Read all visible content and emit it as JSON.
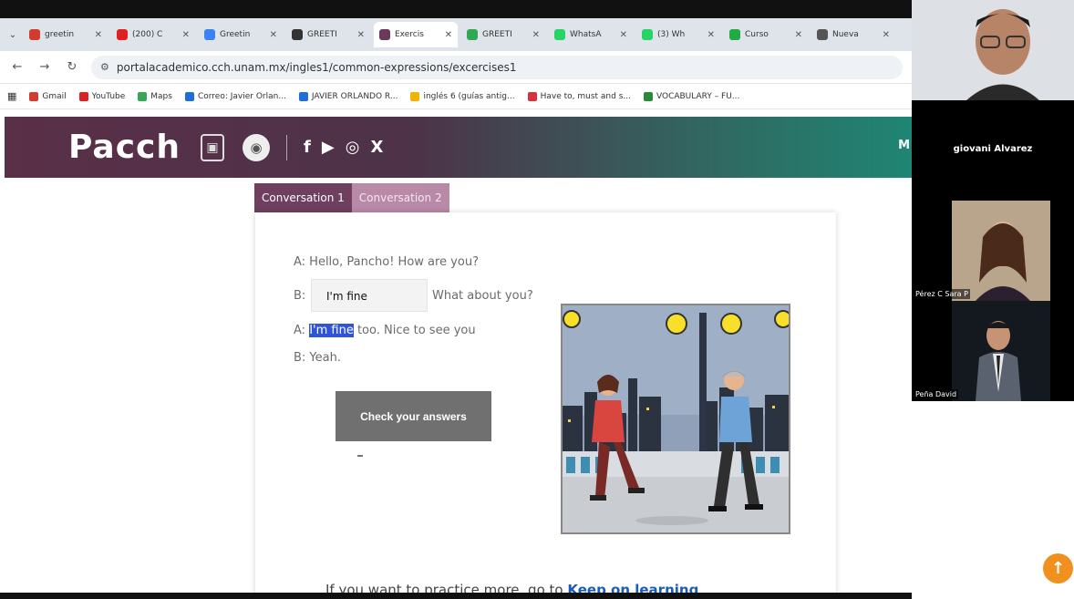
{
  "browser": {
    "tabs": [
      {
        "title": "greetin",
        "fav_color": "#d23b2f"
      },
      {
        "title": "(200) C",
        "fav_color": "#e02020"
      },
      {
        "title": "Greetin",
        "fav_color": "#3b82f6"
      },
      {
        "title": "GREETI",
        "fav_color": "#333333"
      },
      {
        "title": "Exercis",
        "fav_color": "#6b3a5b",
        "active": true
      },
      {
        "title": "GREETI",
        "fav_color": "#33a852"
      },
      {
        "title": "WhatsA",
        "fav_color": "#25d366"
      },
      {
        "title": "(3) Wh",
        "fav_color": "#25d366"
      },
      {
        "title": "Curso",
        "fav_color": "#22aa44"
      },
      {
        "title": "Nueva",
        "fav_color": "#555555"
      }
    ],
    "url": "portalacademico.cch.unam.mx/ingles1/common-expressions/excercises1",
    "bookmarks": [
      {
        "label": "Gmail",
        "color": "#d23b2f"
      },
      {
        "label": "YouTube",
        "color": "#e02020"
      },
      {
        "label": "Maps",
        "color": "#34a853"
      },
      {
        "label": "Correo: Javier Orlan...",
        "color": "#1e6fd9"
      },
      {
        "label": "JAVIER ORLANDO R...",
        "color": "#1e6fd9"
      },
      {
        "label": "inglés 6 (guías antig...",
        "color": "#f2b400"
      },
      {
        "label": "Have to, must and s...",
        "color": "#d8303f"
      },
      {
        "label": "VOCABULARY – FU...",
        "color": "#2a8a3a"
      }
    ]
  },
  "site": {
    "logo": "Pacch",
    "social": [
      "f",
      "▶",
      "◎",
      "X"
    ],
    "menu_letter": "M"
  },
  "exercise": {
    "tabs": [
      "Conversation 1",
      "Conversation 2"
    ],
    "line1": "A: Hello, Pancho! How are you?",
    "line2_prefix": "B:",
    "line2_answer": "I'm fine",
    "line2_suffix": "What about you?",
    "line3_prefix": "A: ",
    "line3_highlight": "I'm fine",
    "line3_suffix": " too. Nice to see you",
    "line4": "B: Yeah.",
    "check_button": "Check your answers",
    "practice_text": "If you want to practice more, go to ",
    "practice_link": "Keep on learning"
  },
  "video": {
    "host_name": "giovani Alvarez",
    "participants": [
      "Pérez C Sara P",
      "Peña David"
    ]
  },
  "icons": {
    "scroll_top": "scroll-top-icon"
  },
  "colors": {
    "brand_plum": "#6e3f5e",
    "brand_teal": "#1f8574",
    "scroll_top": "#f0901e"
  }
}
